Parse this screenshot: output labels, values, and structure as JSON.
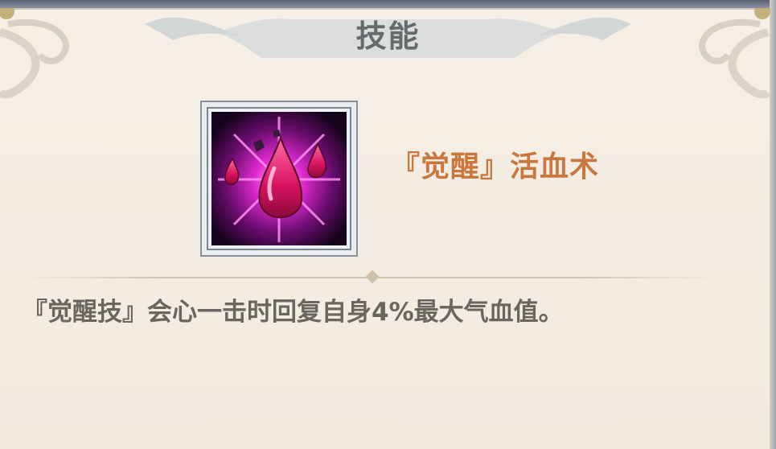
{
  "panel": {
    "title": "技能",
    "skill": {
      "name": "『觉醒』活血术",
      "icon": "blood-drop-skill-icon",
      "description": "『觉醒技』会心一击时回复自身4%最大气血值。"
    }
  },
  "colors": {
    "background": "#f3ede3",
    "title": "#666a6c",
    "skill_name": "#c9773c",
    "description": "#6b6561",
    "icon_glow": "#ff2fd0"
  }
}
